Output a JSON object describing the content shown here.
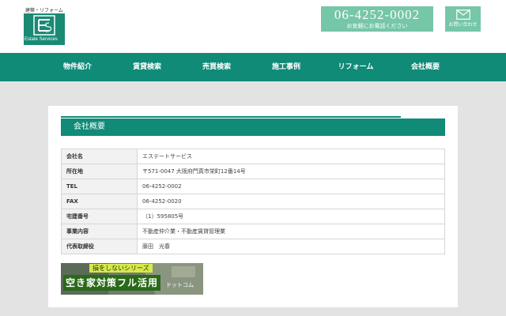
{
  "header": {
    "logo": {
      "tagline": "建築・リフォーム",
      "name": "Estate Services",
      "mark": "es-logo-mark",
      "brand_color": "#1a8a75"
    },
    "phone": {
      "number": "06-4252-0002",
      "caption": "お気軽にお電話ください"
    },
    "contact": {
      "icon": "envelope-icon",
      "label": "お問い合わせ"
    },
    "accent_color": "#76c6a8"
  },
  "nav": {
    "color": "#0f8b78",
    "items": [
      {
        "label": "物件紹介"
      },
      {
        "label": "賃貸検索"
      },
      {
        "label": "売買検索"
      },
      {
        "label": "施工事例"
      },
      {
        "label": "リフォーム"
      },
      {
        "label": "会社概要"
      }
    ]
  },
  "section": {
    "title": "会社概要"
  },
  "company_table": {
    "rows": [
      {
        "key": "会社名",
        "value": "エステートサービス"
      },
      {
        "key": "所在地",
        "value": "〒571-0047 大阪府門真市栄町12番14号"
      },
      {
        "key": "TEL",
        "value": "06-4252-0002"
      },
      {
        "key": "FAX",
        "value": "06-4252-0020"
      },
      {
        "key": "宅建番号",
        "value": "（1）595805号"
      },
      {
        "key": "事業内容",
        "value": "不動産仲介業・不動産賃貸管理業"
      },
      {
        "key": "代表取締役",
        "value": "藤田　光春"
      }
    ]
  },
  "banner": {
    "top_text": "損をしないシリーズ",
    "main_text": "空き家対策フル活用",
    "sub_text": "ドットコム"
  }
}
